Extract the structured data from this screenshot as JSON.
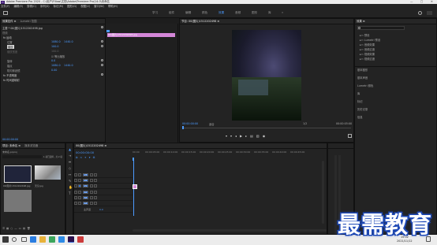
{
  "app": {
    "title": "Adobe Premiere Pro 2020 - C:\\用户\\Fillow\\文档\\Adobe\\Premiere Pro\\14.0\\未命名",
    "logo": "Pr",
    "window_controls": [
      "—",
      "□",
      "✕"
    ]
  },
  "menu": [
    "文件(F)",
    "编辑(E)",
    "剪辑(C)",
    "序列(S)",
    "标记(M)",
    "图形(G)",
    "视图(V)",
    "窗口(W)",
    "帮助(H)"
  ],
  "workspaces": {
    "items": [
      "学习",
      "组件",
      "编辑",
      "颜色",
      "效果",
      "音频",
      "图形",
      "库"
    ],
    "active_index": 4,
    "more": "»"
  },
  "effect_controls": {
    "tabs": [
      "效果控件 ≡",
      "Lumetri 范围",
      "源:（无剪辑）",
      "音频剪辑混合器"
    ],
    "active_tab": 0,
    "source": "主要 * 00(图片)1512202498.jpg",
    "sequence": "00(图片)1512202498.jpg · 00(图片)15...",
    "section_video": "视频",
    "motion": "fx 运动",
    "params": [
      {
        "label": "位置",
        "v1": "1080.0",
        "v2": "1440.0"
      },
      {
        "label": "缩放",
        "v1": "100.0",
        "v2": ""
      },
      {
        "label": "缩放宽度",
        "v1": "100.0",
        "v2": ""
      },
      {
        "label": "",
        "v1": "☑ 等比缩放",
        "v2": ""
      },
      {
        "label": "旋转",
        "v1": "0.0",
        "v2": ""
      },
      {
        "label": "锚点",
        "v1": "1080.0",
        "v2": "1440.0"
      },
      {
        "label": "防闪烁滤镜",
        "v1": "0.00",
        "v2": ""
      }
    ],
    "opacity": "fx 不透明度",
    "time_remap": "fx 时间重映射",
    "timecode": "00:00:00:00",
    "clip_label": "00(图片)1512202498.jpg"
  },
  "program_monitor": {
    "header": "节目: 00(图片)1512202498 ≡",
    "timecode_left": "00:00:00:00",
    "fit": "适合",
    "ratio": "1/2",
    "timecode_right": "00:00:05:00"
  },
  "project": {
    "tabs": [
      "项目: 未命名 ≡",
      "媒体浏览器"
    ],
    "name": "未命名.prproj",
    "count": "1 项已选择，共 2 项",
    "items": [
      {
        "name": "00(图片)1512202498.jpg",
        "duration": "5:00"
      },
      {
        "name": "天空.jpg",
        "duration": "5:00"
      }
    ]
  },
  "timeline": {
    "header": "00(图片)1512202498 ≡",
    "timecode": "00:00:00:00",
    "ruler": [
      "00:00",
      "00:00:05:00",
      "00:00:10:00",
      "00:00:15:00",
      "00:00:20:00",
      "00:00:25:00",
      "00:00:30:00",
      "00:00:35:00",
      "00:00:40:00",
      "00:00:45:00"
    ],
    "video_tracks": [
      "V3",
      "V2",
      "V1"
    ],
    "audio_tracks": [
      "A1",
      "A2",
      "A3"
    ],
    "master": "主声道",
    "master_value": "0.0"
  },
  "effects_panel": {
    "title": "效果 ≡",
    "folders": [
      "预设",
      "Lumetri 预设",
      "音频效果",
      "音频过渡",
      "视频效果",
      "视频过渡"
    ],
    "sections": [
      "基本图形",
      "基本声音",
      "Lumetri 颜色",
      "库",
      "标记",
      "历史记录",
      "信息"
    ]
  },
  "taskbar": {
    "time": "15:02",
    "date": "2021/11/12"
  },
  "watermark": "最需教育",
  "colors": {
    "accent": "#4c9bff",
    "clip": "#d487d8",
    "panel_bg": "#232323",
    "watermark_outline": "#1f4ab8"
  }
}
